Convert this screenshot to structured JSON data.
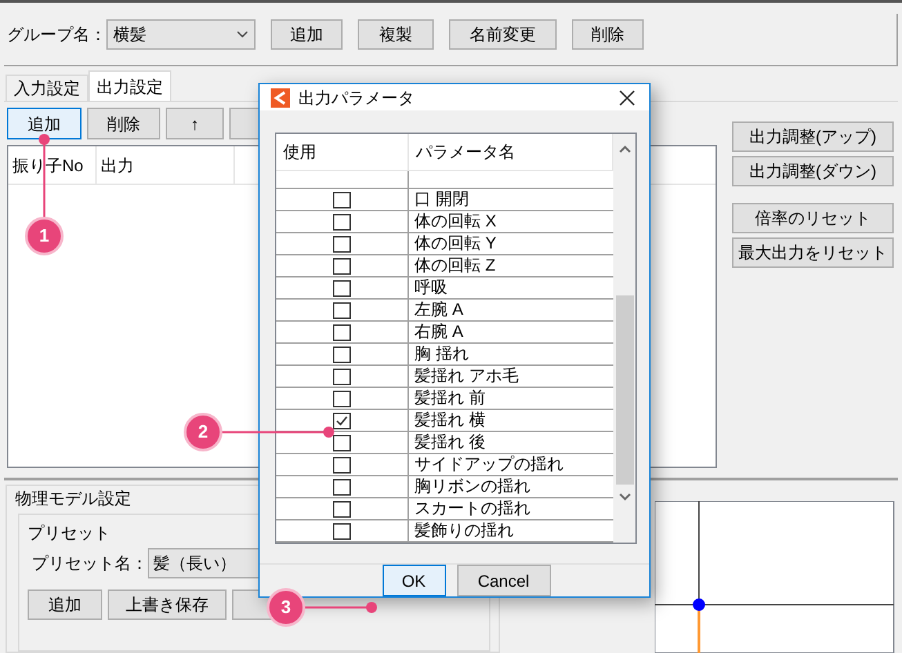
{
  "group": {
    "label": "グループ名：",
    "value": "横髪"
  },
  "group_buttons": [
    "追加",
    "複製",
    "名前変更",
    "削除"
  ],
  "tabs": [
    {
      "label": "入力設定",
      "selected": false
    },
    {
      "label": "出力設定",
      "selected": true
    }
  ],
  "output_toolbar": [
    {
      "label": "追加",
      "selected": true
    },
    {
      "label": "削除",
      "selected": false
    },
    {
      "label": "↑",
      "selected": false
    }
  ],
  "output_table": {
    "columns": [
      "振り子No",
      "出力"
    ]
  },
  "side_buttons": [
    [
      "出力調整(アップ)",
      "出力調整(ダウン)"
    ],
    [
      "倍率のリセット",
      "最大出力をリセット"
    ]
  ],
  "physics": {
    "title": "物理モデル設定",
    "preset_group": "プリセット",
    "preset_label": "プリセット名：",
    "preset_value": "髪（長い）",
    "buttons": [
      "追加",
      "上書き保存"
    ]
  },
  "dialog": {
    "title": "出力パラメータ",
    "columns": [
      "使用",
      "パラメータ名"
    ],
    "rows": [
      {
        "name": "口 開閉",
        "checked": false
      },
      {
        "name": "体の回転 X",
        "checked": false
      },
      {
        "name": "体の回転 Y",
        "checked": false
      },
      {
        "name": "体の回転 Z",
        "checked": false
      },
      {
        "name": "呼吸",
        "checked": false
      },
      {
        "name": "左腕 A",
        "checked": false
      },
      {
        "name": "右腕 A",
        "checked": false
      },
      {
        "name": "胸 揺れ",
        "checked": false
      },
      {
        "name": "髪揺れ アホ毛",
        "checked": false
      },
      {
        "name": "髪揺れ 前",
        "checked": false
      },
      {
        "name": "髪揺れ 横",
        "checked": true
      },
      {
        "name": "髪揺れ 後",
        "checked": false
      },
      {
        "name": "サイドアップの揺れ",
        "checked": false
      },
      {
        "name": "胸リボンの揺れ",
        "checked": false
      },
      {
        "name": "スカートの揺れ",
        "checked": false
      },
      {
        "name": "髪飾りの揺れ",
        "checked": false
      }
    ],
    "buttons": [
      {
        "label": "OK",
        "selected": true
      },
      {
        "label": "Cancel",
        "selected": false
      }
    ]
  },
  "annotations": [
    {
      "number": "1"
    },
    {
      "number": "2"
    },
    {
      "number": "3"
    }
  ]
}
